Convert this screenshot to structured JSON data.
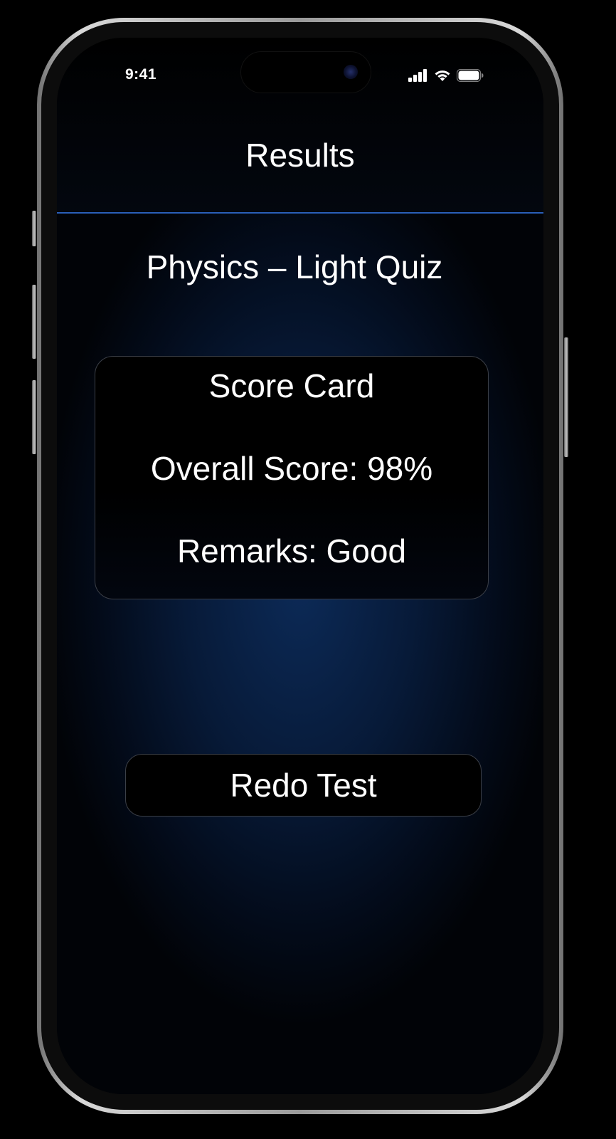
{
  "status_bar": {
    "time": "9:41",
    "icons": [
      "cellular-signal-icon",
      "wifi-icon",
      "battery-icon"
    ]
  },
  "header": {
    "title": "Results"
  },
  "quiz": {
    "title": "Physics – Light Quiz"
  },
  "score_card": {
    "heading": "Score Card",
    "overall_score": "Overall Score: 98%",
    "remarks": "Remarks: Good"
  },
  "actions": {
    "redo_label": "Redo Test"
  },
  "colors": {
    "accent_divider": "#2a5fb8",
    "background_glow": "#0c2a57",
    "card_border": "#3b3f47",
    "text": "#ffffff"
  }
}
